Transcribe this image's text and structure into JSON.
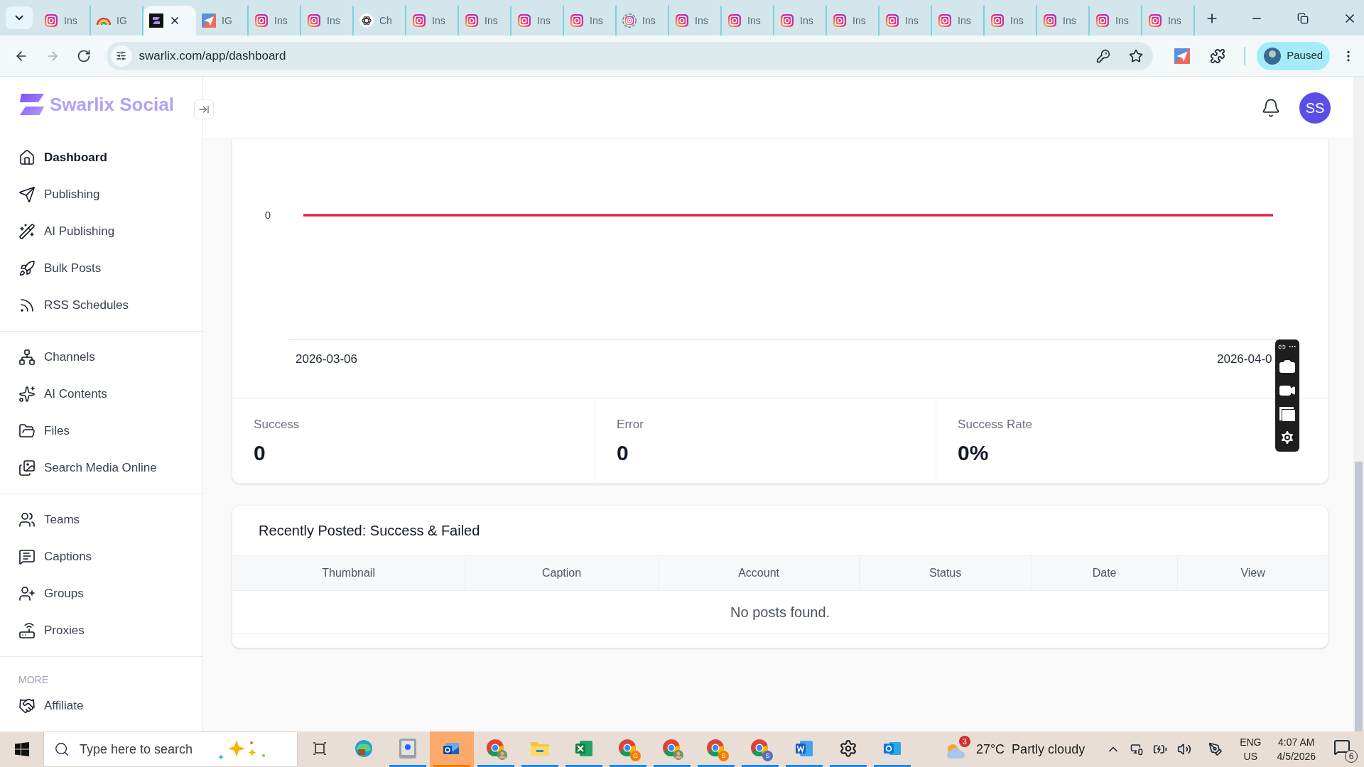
{
  "browser": {
    "tabs": [
      {
        "kind": "instagram",
        "title": "Ins",
        "selected": false
      },
      {
        "kind": "rainbow",
        "title": "IG",
        "selected": false
      },
      {
        "kind": "swarlix",
        "selected": true
      },
      {
        "kind": "plane",
        "title": "IG",
        "selected": false
      },
      {
        "kind": "instagram",
        "title": "Ins",
        "selected": false
      },
      {
        "kind": "instagram",
        "title": "Ins",
        "selected": false
      },
      {
        "kind": "openai",
        "title": "Ch",
        "selected": false
      },
      {
        "kind": "instagram",
        "title": "Ins",
        "selected": false
      },
      {
        "kind": "instagram",
        "title": "Ins",
        "selected": false
      },
      {
        "kind": "instagram",
        "title": "Ins",
        "selected": false
      },
      {
        "kind": "instagram",
        "title": "Ins",
        "selected": false
      },
      {
        "kind": "ring",
        "title": "Ins",
        "selected": false
      },
      {
        "kind": "instagram",
        "title": "Ins",
        "selected": false
      },
      {
        "kind": "instagram",
        "title": "Ins",
        "selected": false
      },
      {
        "kind": "instagram",
        "title": "Ins",
        "selected": false
      },
      {
        "kind": "instagram",
        "title": "Ins",
        "selected": false
      },
      {
        "kind": "instagram",
        "title": "Ins",
        "selected": false
      },
      {
        "kind": "instagram",
        "title": "Ins",
        "selected": false
      },
      {
        "kind": "instagram",
        "title": "Ins",
        "selected": false
      },
      {
        "kind": "instagram",
        "title": "Ins",
        "selected": false
      },
      {
        "kind": "instagram",
        "title": "Ins",
        "selected": false
      },
      {
        "kind": "instagram",
        "title": "Ins",
        "selected": false
      }
    ],
    "nav_buttons": [
      {
        "kind": "back",
        "disabled": false
      },
      {
        "kind": "forward",
        "disabled": true
      },
      {
        "kind": "reload",
        "disabled": false
      }
    ],
    "address": "swarlix.com/app/dashboard",
    "profile": "Paused"
  },
  "sidebar": {
    "brand": "Swarlix Social",
    "groups": [
      {
        "items": [
          {
            "label": "Dashboard",
            "kind": "home",
            "selected": true
          },
          {
            "label": "Publishing",
            "kind": "send",
            "selected": false
          },
          {
            "label": "AI Publishing",
            "kind": "wand",
            "selected": false
          },
          {
            "label": "Bulk Posts",
            "kind": "rocket",
            "selected": false
          },
          {
            "label": "RSS Schedules",
            "kind": "rss",
            "selected": false
          }
        ]
      },
      {
        "items": [
          {
            "label": "Channels",
            "kind": "nodes",
            "selected": false
          },
          {
            "label": "AI Contents",
            "kind": "sparkles",
            "selected": false
          },
          {
            "label": "Files",
            "kind": "folder",
            "selected": false
          },
          {
            "label": "Search Media Online",
            "kind": "images",
            "selected": false
          }
        ]
      },
      {
        "items": [
          {
            "label": "Teams",
            "kind": "people",
            "selected": false
          },
          {
            "label": "Captions",
            "kind": "message",
            "selected": false
          },
          {
            "label": "Groups",
            "kind": "user-plus",
            "selected": false
          },
          {
            "label": "Proxies",
            "kind": "router",
            "selected": false
          }
        ]
      },
      {
        "heading": "MORE",
        "items": [
          {
            "label": "Affiliate",
            "kind": "handshake",
            "selected": false
          }
        ]
      }
    ]
  },
  "header": {
    "avatar": "SS"
  },
  "chart": {
    "kind": "line",
    "y_tick": "0",
    "x_ticks": [
      "2026-03-06",
      "2026-04-0"
    ]
  },
  "stats": [
    {
      "label": "Success",
      "value": "0"
    },
    {
      "label": "Error",
      "value": "0"
    },
    {
      "label": "Success Rate",
      "value": "0%"
    }
  ],
  "recent": {
    "title": "Recently Posted: Success & Failed",
    "columns": [
      "Thumbnail",
      "Caption",
      "Account",
      "Status",
      "Date",
      "View"
    ],
    "empty": "No posts found."
  },
  "taskbar": {
    "search_placeholder": "Type here to search",
    "apps": [
      {
        "kind": "taskview",
        "running": false,
        "selected": false
      },
      {
        "kind": "edge",
        "running": false,
        "selected": false
      },
      {
        "kind": "device",
        "running": true,
        "selected": false
      },
      {
        "kind": "outlook-new",
        "running": true,
        "selected": true
      },
      {
        "kind": "chrome-photo",
        "running": true,
        "selected": false
      },
      {
        "kind": "folder",
        "running": true,
        "selected": false
      },
      {
        "kind": "excel",
        "running": true,
        "selected": false
      },
      {
        "kind": "chrome",
        "badge": "G",
        "running": true,
        "selected": false
      },
      {
        "kind": "chrome-photo",
        "running": true,
        "selected": false
      },
      {
        "kind": "chrome",
        "badge": "S",
        "running": true,
        "selected": false
      },
      {
        "kind": "chrome",
        "badge": "S",
        "running": true,
        "selected": false
      },
      {
        "kind": "word",
        "running": true,
        "selected": false
      },
      {
        "kind": "gear",
        "running": true,
        "selected": false
      },
      {
        "kind": "outlook",
        "running": true,
        "selected": false
      }
    ],
    "weather": {
      "badge": "3",
      "temperature": "27°C",
      "condition": "Partly cloudy"
    },
    "language": "ENG",
    "region": "US",
    "time": "4:07 AM",
    "date": "4/5/2026",
    "notifications": "6"
  }
}
